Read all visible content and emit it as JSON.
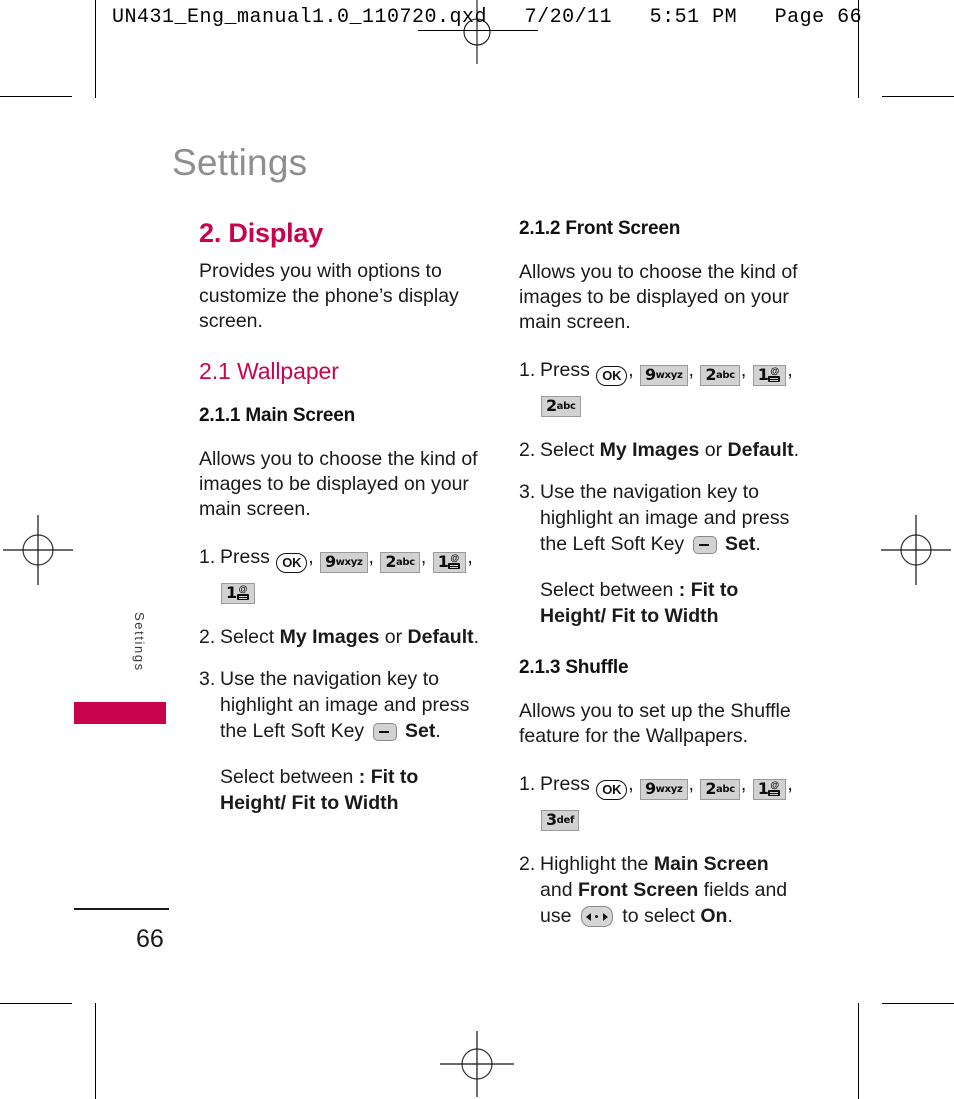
{
  "prepress": {
    "header_text": "UN431_Eng_manual1.0_110720.qxd   7/20/11   5:51 PM   Page 66"
  },
  "page": {
    "doc_title": "Settings",
    "side_tab_label": "Settings",
    "page_number": "66",
    "accent_color": "#c8044f",
    "title_color": "#8e8e8e"
  },
  "left_column": {
    "section_heading": "2. Display",
    "section_intro": "Provides you with options to customize the phone’s display screen.",
    "sub_heading": "2.1 Wallpaper",
    "topic_heading": "2.1.1 Main Screen",
    "topic_intro": "Allows you to choose the kind of images to be displayed on your main screen.",
    "steps": [
      {
        "num": "1.",
        "lead": "Press",
        "keys": [
          "OK",
          "9wxyz",
          "2abc",
          "1-voicemail",
          "1-voicemail"
        ],
        "sep": ","
      },
      {
        "num": "2.",
        "text_parts": [
          "Select ",
          "My Images",
          " or ",
          "Default",
          "."
        ]
      },
      {
        "num": "3.",
        "text_parts": [
          "Use the navigation key to highlight an image and press the Left Soft Key ",
          "left-soft-key",
          " ",
          "Set",
          "."
        ]
      }
    ],
    "note_label": "Select between",
    "note_colon": ":",
    "note_value": "Fit to Height/ Fit to Width"
  },
  "right_column": {
    "topics": [
      {
        "topic_heading": "2.1.2 Front Screen",
        "topic_intro": "Allows you to choose the kind of images to be displayed on your main screen.",
        "steps": [
          {
            "num": "1.",
            "lead": "Press",
            "keys": [
              "OK",
              "9wxyz",
              "2abc",
              "1-voicemail",
              "2abc"
            ]
          },
          {
            "num": "2.",
            "text_parts": [
              "Select ",
              "My Images",
              " or ",
              "Default",
              "."
            ]
          },
          {
            "num": "3.",
            "text_parts": [
              "Use the navigation key to highlight an image and press the Left Soft Key ",
              "left-soft-key",
              " ",
              "Set",
              "."
            ]
          }
        ],
        "note_label": "Select between",
        "note_colon": ":",
        "note_value": "Fit to Height/ Fit to Width"
      },
      {
        "topic_heading": "2.1.3 Shuffle",
        "topic_intro": "Allows you to set up the Shuffle feature for the Wallpapers.",
        "steps": [
          {
            "num": "1.",
            "lead": "Press",
            "keys": [
              "OK",
              "9wxyz",
              "2abc",
              "1-voicemail",
              "3def"
            ]
          },
          {
            "num": "2.",
            "text_parts": [
              "Highlight the ",
              "Main Screen",
              " and ",
              "Front Screen",
              " fields and use ",
              "nav-left-right-key",
              " to select ",
              "On",
              "."
            ]
          }
        ]
      }
    ]
  },
  "labels": {
    "press": "Press",
    "select": "Select",
    "or": "or",
    "my_images": "My Images",
    "default": "Default",
    "use_nav_1": "Use the navigation key to",
    "use_nav_2": "highlight an image and press",
    "use_nav_3a": "the Left Soft Key",
    "use_nav_3b": "Set",
    "period": ".",
    "select_between": "Select between",
    "colon": ":",
    "fit_to": "Fit to",
    "height_width": "Height/ Fit to Width",
    "highlight_the": "Highlight the",
    "main_screen": "Main Screen",
    "and": "and",
    "front_screen": "Front Screen",
    "fields_and": "fields and",
    "use": "use",
    "to_select": "to select",
    "on": "On",
    "step1": "1.",
    "step2": "2.",
    "step3": "3.",
    "key_9": "9",
    "key_9_sub": "wxyz",
    "key_2": "2",
    "key_2_sub": "abc",
    "key_1": "1",
    "key_3": "3",
    "key_3_sub": "def",
    "key_ok": "OK",
    "vm_at": "@"
  }
}
